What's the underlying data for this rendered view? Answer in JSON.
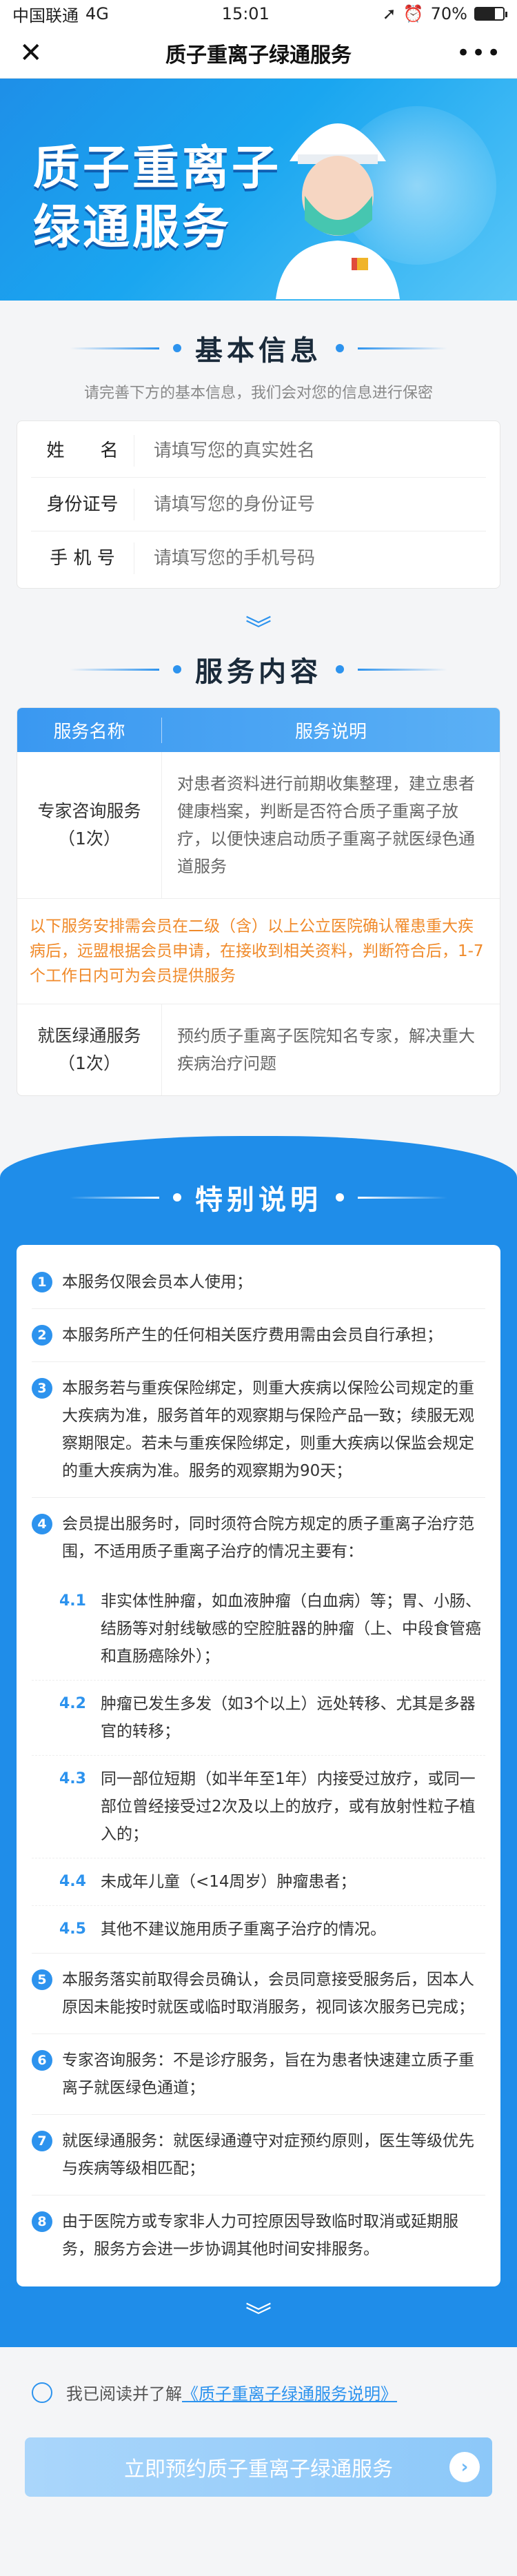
{
  "status_bar": {
    "carrier": "中国联通",
    "network": "4G",
    "time": "15:01",
    "battery": "70%"
  },
  "navbar": {
    "title": "质子重离子绿通服务",
    "close_icon": "close-icon",
    "more_icon": "more-icon"
  },
  "hero": {
    "title_line1": "质子重离子",
    "title_line2": "绿通服务"
  },
  "basic_info": {
    "title": "基本信息",
    "subtitle": "请完善下方的基本信息，我们会对您的信息进行保密",
    "fields": [
      {
        "label": "姓　　名",
        "placeholder": "请填写您的真实姓名"
      },
      {
        "label": "身份证号",
        "placeholder": "请填写您的身份证号"
      },
      {
        "label": "手 机 号",
        "placeholder": "请填写您的手机号码"
      }
    ]
  },
  "service": {
    "title": "服务内容",
    "col_name": "服务名称",
    "col_desc": "服务说明",
    "rows": [
      {
        "name": "专家咨询服务",
        "count": "（1次）",
        "desc": "对患者资料进行前期收集整理，建立患者健康档案，判断是否符合质子重离子放疗，以便快速启动质子重离子就医绿色通道服务"
      },
      {
        "name": "就医绿通服务",
        "count": "（1次）",
        "desc": "预约质子重离子医院知名专家，解决重大疾病治疗问题"
      }
    ],
    "note": "以下服务安排需会员在二级（含）以上公立医院确认罹患重大疾病后，远盟根据会员申请，在接收到相关资料，判断符合后，1-7个工作日内可为会员提供服务"
  },
  "special": {
    "title": "特别说明",
    "rules": [
      {
        "num": "1",
        "text": "本服务仅限会员本人使用；"
      },
      {
        "num": "2",
        "text": "本服务所产生的任何相关医疗费用需由会员自行承担；"
      },
      {
        "num": "3",
        "text": "本服务若与重疾保险绑定，则重大疾病以保险公司规定的重大疾病为准，服务首年的观察期与保险产品一致；续服无观察期限定。若未与重疾保险绑定，则重大疾病以保监会规定的重大疾病为准。服务的观察期为90天；"
      },
      {
        "num": "4",
        "text": "会员提出服务时，同时须符合院方规定的质子重离子治疗范围，不适用质子重离子治疗的情况主要有："
      },
      {
        "num": "5",
        "text": "本服务落实前取得会员确认，会员同意接受服务后，因本人原因未能按时就医或临时取消服务，视同该次服务已完成；"
      },
      {
        "num": "6",
        "text": "专家咨询服务：不是诊疗服务，旨在为患者快速建立质子重离子就医绿色通道；"
      },
      {
        "num": "7",
        "text": "就医绿通服务：就医绿通遵守对症预约原则，医生等级优先与疾病等级相匹配；"
      },
      {
        "num": "8",
        "text": "由于医院方或专家非人力可控原因导致临时取消或延期服务，服务方会进一步协调其他时间安排服务。"
      }
    ],
    "subs": [
      {
        "num": "4.1",
        "text": "非实体性肿瘤，如血液肿瘤（白血病）等；胃、小肠、结肠等对射线敏感的空腔脏器的肿瘤（上、中段食管癌和直肠癌除外）；"
      },
      {
        "num": "4.2",
        "text": "肿瘤已发生多发（如3个以上）远处转移、尤其是多器官的转移；"
      },
      {
        "num": "4.3",
        "text": "同一部位短期（如半年至1年）内接受过放疗，或同一部位曾经接受过2次及以上的放疗，或有放射性粒子植入的；"
      },
      {
        "num": "4.4",
        "text": "未成年儿童（<14周岁）肿瘤患者；"
      },
      {
        "num": "4.5",
        "text": "其他不建议施用质子重离子治疗的情况。"
      }
    ]
  },
  "agreement": {
    "prefix": "我已阅读并了解",
    "link": "《质子重离子绿通服务说明》"
  },
  "submit": {
    "label": "立即预约质子重离子绿通服务"
  }
}
